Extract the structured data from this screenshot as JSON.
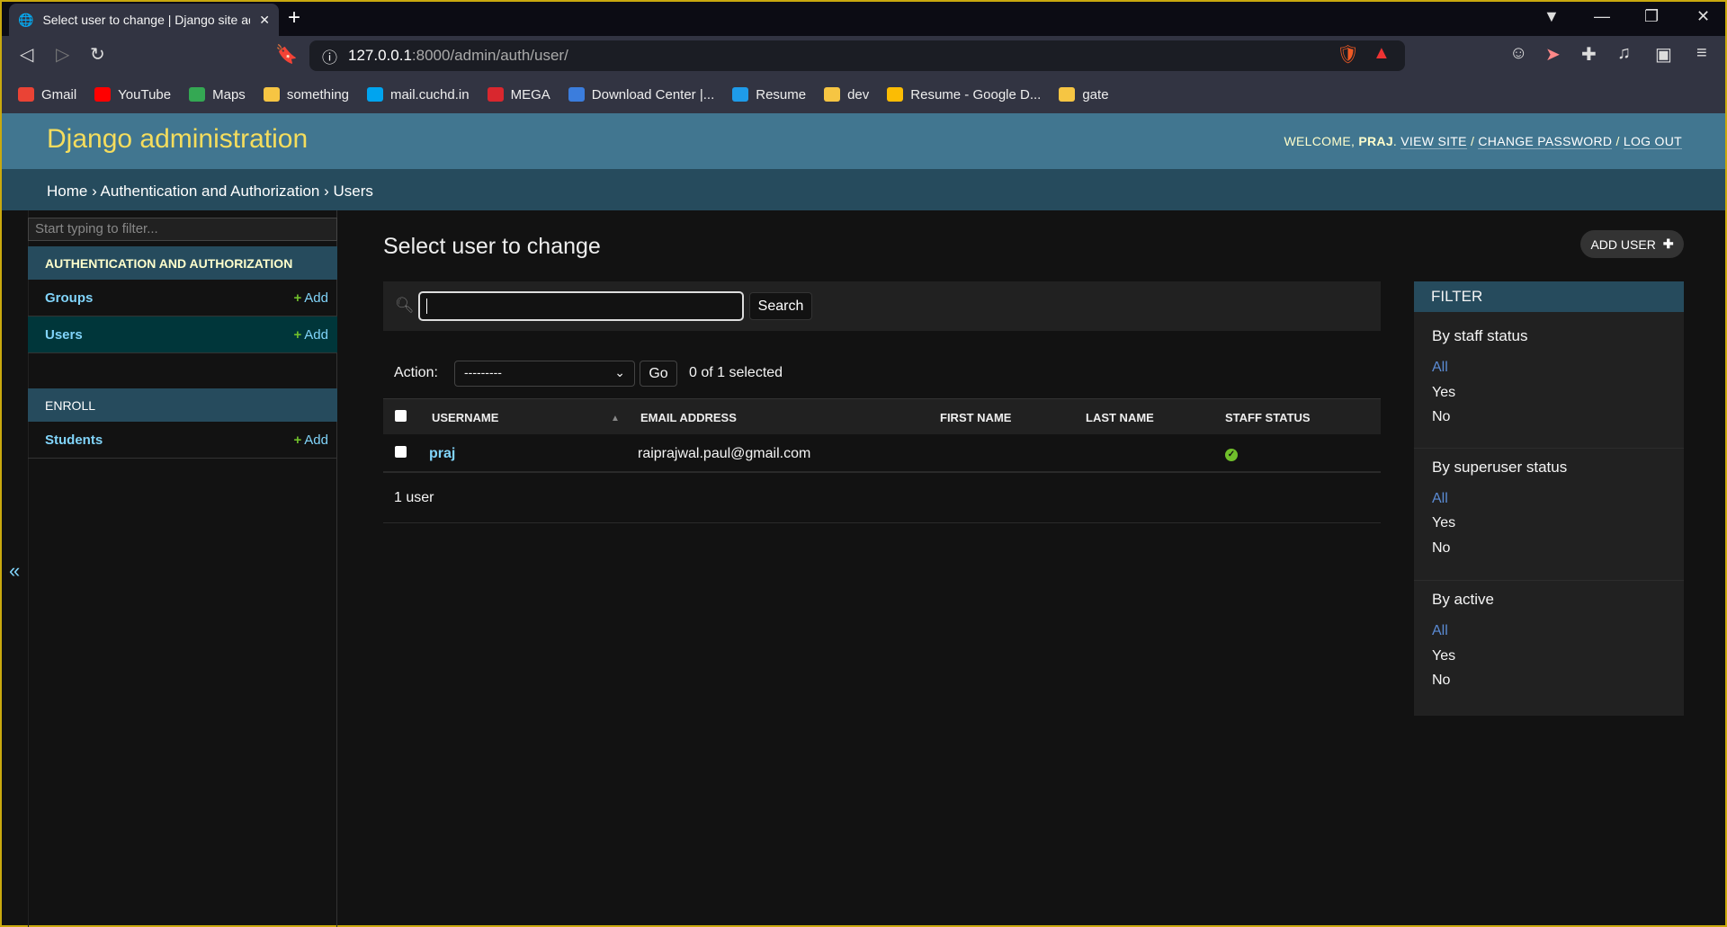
{
  "browser": {
    "tab_title": "Select user to change | Django site admin",
    "url_host": "127.0.0.1",
    "url_path": ":8000/admin/auth/user/",
    "bookmarks": [
      {
        "label": "Gmail",
        "color": "#ea4335"
      },
      {
        "label": "YouTube",
        "color": "#ff0000"
      },
      {
        "label": "Maps",
        "color": "#34a853"
      },
      {
        "label": "something",
        "color": "#f6c543"
      },
      {
        "label": "mail.cuchd.in",
        "color": "#00a4ef"
      },
      {
        "label": "MEGA",
        "color": "#d9272e"
      },
      {
        "label": "Download Center |...",
        "color": "#3b7ddd"
      },
      {
        "label": "Resume",
        "color": "#1e9be9"
      },
      {
        "label": "dev",
        "color": "#f6c543"
      },
      {
        "label": "Resume - Google D...",
        "color": "#fbbc04"
      },
      {
        "label": "gate",
        "color": "#f6c543"
      }
    ]
  },
  "header": {
    "brand": "Django administration",
    "welcome": "WELCOME,",
    "user": "PRAJ",
    "view_site": "VIEW SITE",
    "change_password": "CHANGE PASSWORD",
    "log_out": "LOG OUT"
  },
  "breadcrumbs": {
    "home": "Home",
    "app": "Authentication and Authorization",
    "current": "Users"
  },
  "sidebar": {
    "filter_placeholder": "Start typing to filter...",
    "collapse": "«",
    "modules": [
      {
        "title": "AUTHENTICATION AND AUTHORIZATION",
        "items": [
          {
            "label": "Groups",
            "add": "Add"
          },
          {
            "label": "Users",
            "add": "Add"
          }
        ]
      },
      {
        "title": "ENROLL",
        "items": [
          {
            "label": "Students",
            "add": "Add"
          }
        ]
      }
    ]
  },
  "main": {
    "title": "Select user to change",
    "add_user": "ADD USER",
    "search_button": "Search",
    "action_label": "Action:",
    "action_value": "---------",
    "go": "Go",
    "selected": "0 of 1 selected",
    "columns": [
      "USERNAME",
      "EMAIL ADDRESS",
      "FIRST NAME",
      "LAST NAME",
      "STAFF STATUS"
    ],
    "rows": [
      {
        "username": "praj",
        "email": "raiprajwal.paul@gmail.com",
        "first_name": "",
        "last_name": "",
        "staff_status": true
      }
    ],
    "count": "1 user"
  },
  "filter": {
    "title": "FILTER",
    "groups": [
      {
        "title": "By staff status",
        "options": [
          "All",
          "Yes",
          "No"
        ]
      },
      {
        "title": "By superuser status",
        "options": [
          "All",
          "Yes",
          "No"
        ]
      },
      {
        "title": "By active",
        "options": [
          "All",
          "Yes",
          "No"
        ]
      }
    ]
  },
  "colors": {
    "header": "#417690",
    "breadcrumbs": "#264b5d",
    "brand": "#f5dd5d",
    "link": "#81d4fa",
    "add": "#70bf2b"
  }
}
